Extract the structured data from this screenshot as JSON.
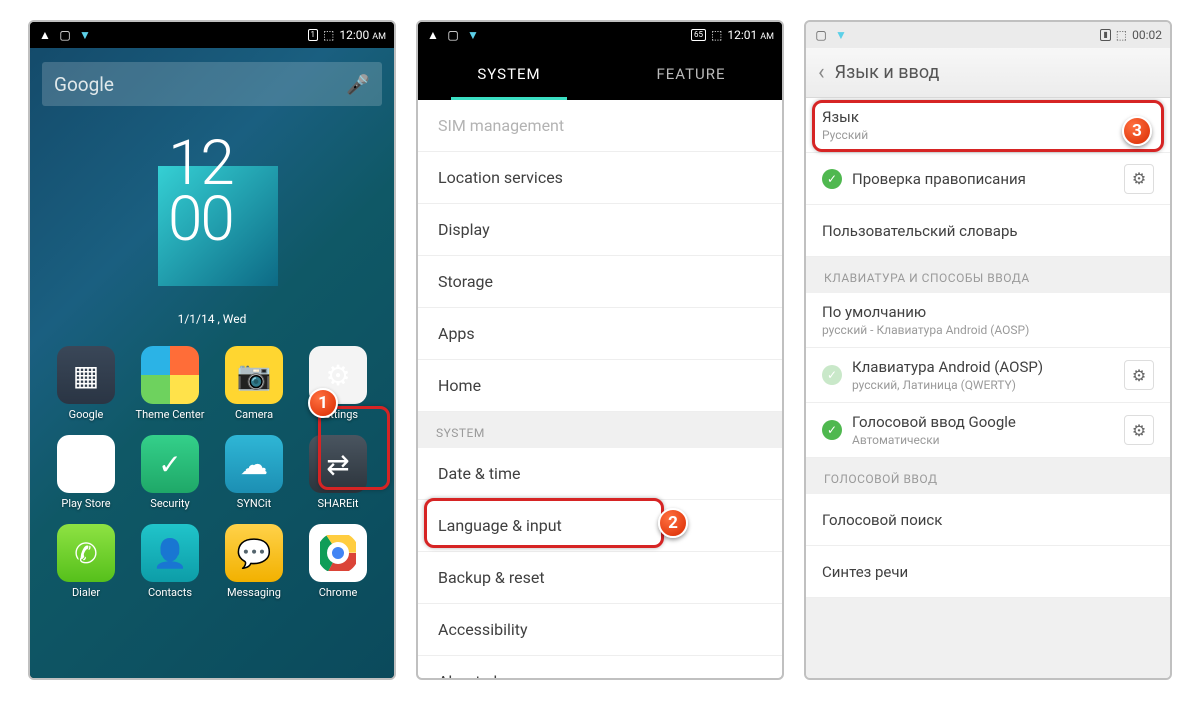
{
  "phone1": {
    "status": {
      "time": "12:00",
      "ampm": "AM",
      "battery": "1"
    },
    "search_placeholder": "Google",
    "clock": {
      "line1": "12",
      "line2": "00",
      "date": "1/1/14 , Wed"
    },
    "apps": {
      "google": "Google",
      "theme": "Theme Center",
      "camera": "Camera",
      "settings": "Settings",
      "play": "Play Store",
      "security": "Security",
      "sync": "SYNCit",
      "share": "SHAREit",
      "dialer": "Dialer",
      "contacts": "Contacts",
      "messaging": "Messaging",
      "chrome": "Chrome"
    },
    "badge": "1"
  },
  "phone2": {
    "status": {
      "time": "12:01",
      "ampm": "AM",
      "battery": "65"
    },
    "tabs": {
      "system": "SYSTEM",
      "feature": "FEATURE"
    },
    "items": {
      "sim": "SIM management",
      "location": "Location services",
      "display": "Display",
      "storage": "Storage",
      "apps": "Apps",
      "home": "Home",
      "section_system": "SYSTEM",
      "datetime": "Date & time",
      "language": "Language & input",
      "backup": "Backup & reset",
      "accessibility": "Accessibility",
      "about": "About phone"
    },
    "badge": "2"
  },
  "phone3": {
    "status": {
      "time": "00:02"
    },
    "header": "Язык и ввод",
    "items": {
      "lang_title": "Язык",
      "lang_sub": "Русский",
      "spellcheck": "Проверка правописания",
      "userdict": "Пользовательский словарь",
      "section_kb": "КЛАВИАТУРА И СПОСОБЫ ВВОДА",
      "default_title": "По умолчанию",
      "default_sub": "русский - Клавиатура Android (AOSP)",
      "aosp_title": "Клавиатура Android (AOSP)",
      "aosp_sub": "русский, Латиница (QWERTY)",
      "gvoice_title": "Голосовой ввод Google",
      "gvoice_sub": "Автоматически",
      "section_voice": "ГОЛОСОВОЙ ВВОД",
      "vsearch": "Голосовой поиск",
      "tts": "Синтез речи"
    },
    "badge": "3"
  }
}
